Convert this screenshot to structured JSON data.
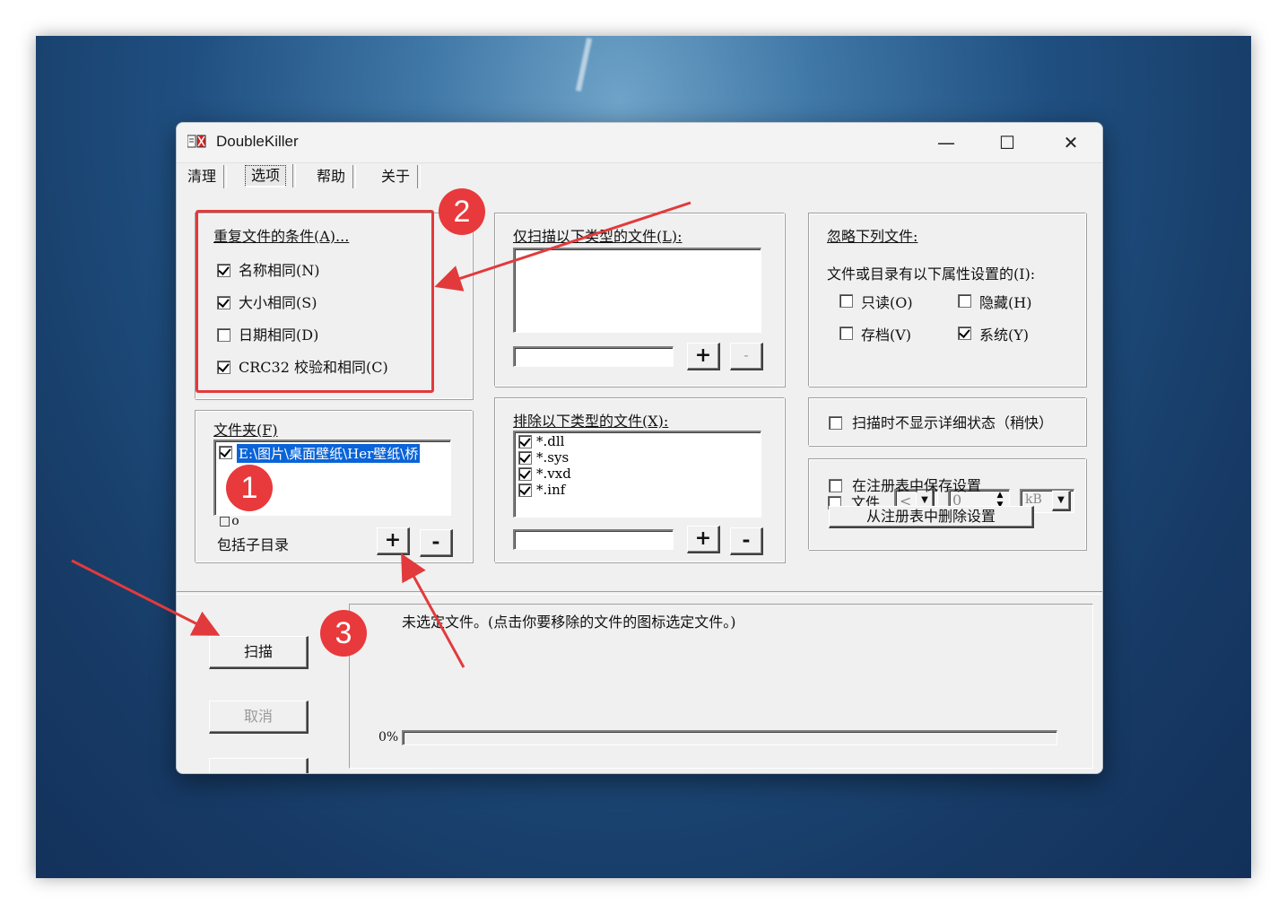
{
  "window": {
    "title": "DoubleKiller",
    "minimize": "—",
    "maximize": "☐",
    "close": "✕"
  },
  "menu": {
    "tabs": [
      "清理",
      "选项",
      "帮助",
      "关于"
    ],
    "active_tab": "选项"
  },
  "dup_conditions": {
    "title": "重复文件的条件(A)...",
    "options": [
      {
        "label": "名称相同(N)",
        "checked": true
      },
      {
        "label": "大小相同(S)",
        "checked": true
      },
      {
        "label": "日期相同(D)",
        "checked": false
      },
      {
        "label": "CRC32 校验和相同(C)",
        "checked": true
      }
    ]
  },
  "folders": {
    "title": "文件夹(F)",
    "items": [
      {
        "path": "E:\\图片\\桌面壁纸\\Her壁纸\\桥",
        "checked": true
      }
    ],
    "glyph": "□o",
    "include_subdirs_label": "包括子目录",
    "add_label": "+",
    "remove_label": "-"
  },
  "scan_only": {
    "title": "仅扫描以下类型的文件(L):",
    "input_value": "",
    "add_label": "+",
    "remove_label": "-"
  },
  "exclude": {
    "title": "排除以下类型的文件(X):",
    "items": [
      {
        "label": "*.dll",
        "checked": true
      },
      {
        "label": "*.sys",
        "checked": true
      },
      {
        "label": "*.vxd",
        "checked": true
      },
      {
        "label": "*.inf",
        "checked": true
      }
    ],
    "input_value": "",
    "add_label": "+",
    "remove_label": "-"
  },
  "ignore": {
    "title": "忽略下列文件:",
    "attr_label": "文件或目录有以下属性设置的(I):",
    "attrs": [
      {
        "label": "只读(O)",
        "checked": false
      },
      {
        "label": "隐藏(H)",
        "checked": false
      },
      {
        "label": "存档(V)",
        "checked": false
      },
      {
        "label": "系统(Y)",
        "checked": true
      }
    ],
    "file_label": "文件",
    "file_checked": false,
    "compare_value": "<",
    "size_value": "0",
    "unit_value": "kB"
  },
  "no_detail": {
    "label": "扫描时不显示详细状态（稍快）",
    "checked": false
  },
  "registry": {
    "save_label": "在注册表中保存设置",
    "save_checked": false,
    "delete_label": "从注册表中删除设置"
  },
  "bottom": {
    "scan_label": "扫描",
    "cancel_label": "取消",
    "status_text": "未选定文件。(点击你要移除的文件的图标选定文件。)",
    "progress_label": "0%",
    "progress_value": 0
  },
  "annotations": {
    "one": "1",
    "two": "2",
    "three": "3"
  },
  "colors": {
    "annotation_red": "#e8393c",
    "selection_blue": "#0a64d8"
  }
}
